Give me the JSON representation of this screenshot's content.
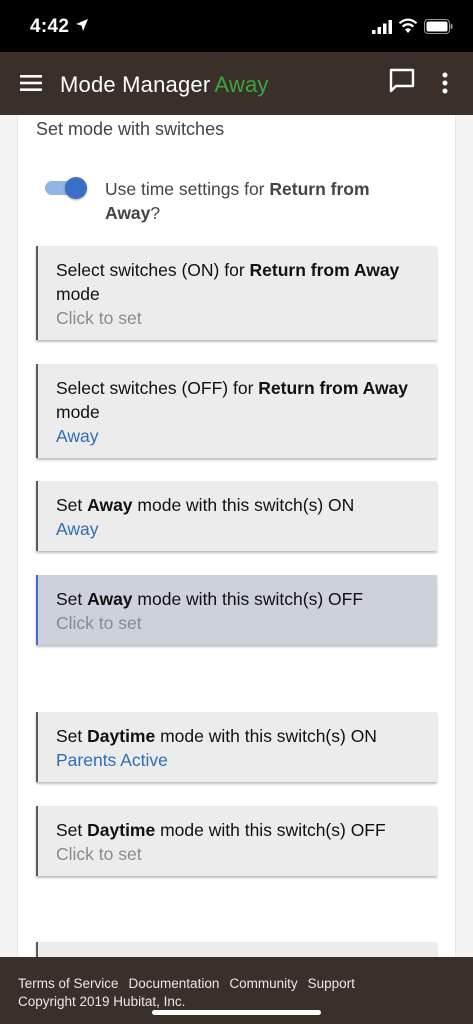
{
  "status_bar": {
    "time": "4:42"
  },
  "app_bar": {
    "title": "Mode Manager",
    "mode": "Away"
  },
  "section": {
    "title": "Set mode with switches"
  },
  "toggle": {
    "prefix": "Use time settings for ",
    "bold": "Return from Away",
    "suffix": "?",
    "state": "on"
  },
  "settings": [
    {
      "prefix": "Select switches (ON) for ",
      "bold": "Return from Away",
      "suffix": " mode",
      "value": "Click to set"
    },
    {
      "prefix": "Select switches (OFF) for ",
      "bold": "Return from Away",
      "suffix": " mode",
      "value": "Away"
    },
    {
      "prefix": "Set ",
      "bold": "Away",
      "suffix": " mode with this switch(s) ON",
      "value": "Away"
    },
    {
      "prefix": "Set ",
      "bold": "Away",
      "suffix": " mode with this switch(s) OFF",
      "value": "Click to set"
    },
    {
      "prefix": "Set ",
      "bold": "Daytime",
      "suffix": " mode with this switch(s) ON",
      "value": "Parents Active"
    },
    {
      "prefix": "Set ",
      "bold": "Daytime",
      "suffix": " mode with this switch(s) OFF",
      "value": "Click to set"
    }
  ],
  "footer": {
    "links": [
      "Terms of Service",
      "Documentation",
      "Community",
      "Support"
    ],
    "copyright": "Copyright 2019 Hubitat, Inc."
  },
  "colors": {
    "app_bar": "#3b2f2a",
    "mode_accent": "#3aa53d",
    "link_value": "#2f6db5",
    "placeholder": "#8a8a8a",
    "active_row": "#cdd1dc"
  }
}
